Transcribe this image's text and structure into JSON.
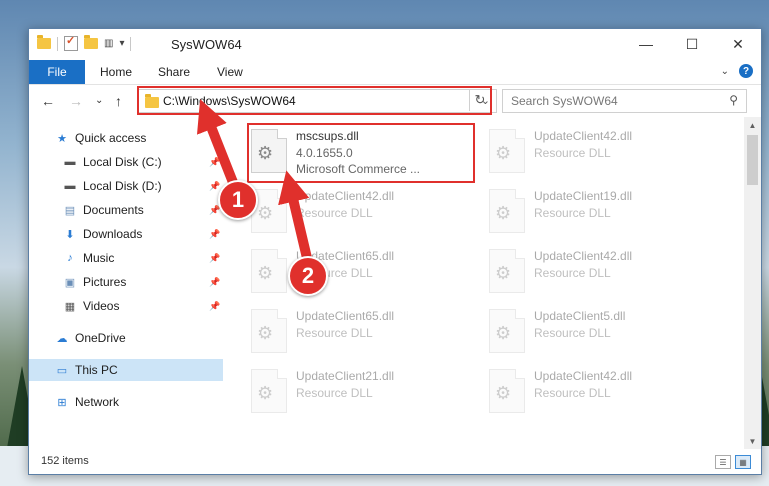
{
  "window": {
    "title": "SysWOW64"
  },
  "titlebar": {
    "qa_overflow_glyph": "▾",
    "minimize": "—",
    "maximize": "☐",
    "close": "✕"
  },
  "ribbon": {
    "file": "File",
    "home": "Home",
    "share": "Share",
    "view": "View",
    "expand": "⌄",
    "help": "?"
  },
  "nav": {
    "back": "←",
    "forward": "→",
    "recent": "⌄",
    "up": "↑",
    "address": "C:\\Windows\\SysWOW64",
    "address_dropdown": "⌄",
    "refresh": "↻",
    "search_placeholder": "Search SysWOW64",
    "search_icon": "⚲"
  },
  "sidebar": {
    "items": [
      {
        "label": "Quick access",
        "icon": "star-icon",
        "glyph": "★",
        "color": "#2b7cd3"
      },
      {
        "label": "Local Disk (C:)",
        "icon": "drive-icon",
        "glyph": "▬",
        "color": "#555",
        "pinned": "📌"
      },
      {
        "label": "Local Disk (D:)",
        "icon": "drive-icon",
        "glyph": "▬",
        "color": "#555",
        "pinned": "📌"
      },
      {
        "label": "Documents",
        "icon": "documents-icon",
        "glyph": "▤",
        "color": "#6b8fb8",
        "pinned": "📌"
      },
      {
        "label": "Downloads",
        "icon": "downloads-icon",
        "glyph": "⬇",
        "color": "#2b7cd3",
        "pinned": "📌"
      },
      {
        "label": "Music",
        "icon": "music-icon",
        "glyph": "♪",
        "color": "#2b7cd3",
        "pinned": "📌"
      },
      {
        "label": "Pictures",
        "icon": "pictures-icon",
        "glyph": "▣",
        "color": "#6b8fb8",
        "pinned": "📌"
      },
      {
        "label": "Videos",
        "icon": "videos-icon",
        "glyph": "▦",
        "color": "#555",
        "pinned": "📌"
      },
      {
        "label": "OneDrive",
        "icon": "onedrive-icon",
        "glyph": "☁",
        "color": "#2b7cd3"
      },
      {
        "label": "This PC",
        "icon": "pc-icon",
        "glyph": "▭",
        "color": "#2b7cd3"
      },
      {
        "label": "Network",
        "icon": "network-icon",
        "glyph": "⊞",
        "color": "#2b7cd3"
      }
    ]
  },
  "files": {
    "highlighted": {
      "name": "mscsups.dll",
      "version": "4.0.1655.0",
      "company": "Microsoft Commerce ..."
    },
    "left_col": [
      {
        "name": "UpdateClient42.dll",
        "type": "Resource DLL"
      },
      {
        "name": "UpdateClient65.dll",
        "type": "Resource DLL"
      },
      {
        "name": "UpdateClient65.dll",
        "type": "Resource DLL"
      },
      {
        "name": "UpdateClient21.dll",
        "type": "Resource DLL"
      }
    ],
    "right_col": [
      {
        "name": "UpdateClient42.dll",
        "type": "Resource DLL"
      },
      {
        "name": "UpdateClient19.dll",
        "type": "Resource DLL"
      },
      {
        "name": "UpdateClient42.dll",
        "type": "Resource DLL"
      },
      {
        "name": "UpdateClient5.dll",
        "type": "Resource DLL"
      },
      {
        "name": "UpdateClient42.dll",
        "type": "Resource DLL"
      }
    ],
    "gear_glyph": "⚙"
  },
  "scrollbar": {
    "up": "▲",
    "down": "▼"
  },
  "status": {
    "count": "152 items",
    "details_view": "☰",
    "icons_view": "▦"
  },
  "annotations": {
    "step1": "1",
    "step2": "2",
    "color": "#e0302c"
  }
}
